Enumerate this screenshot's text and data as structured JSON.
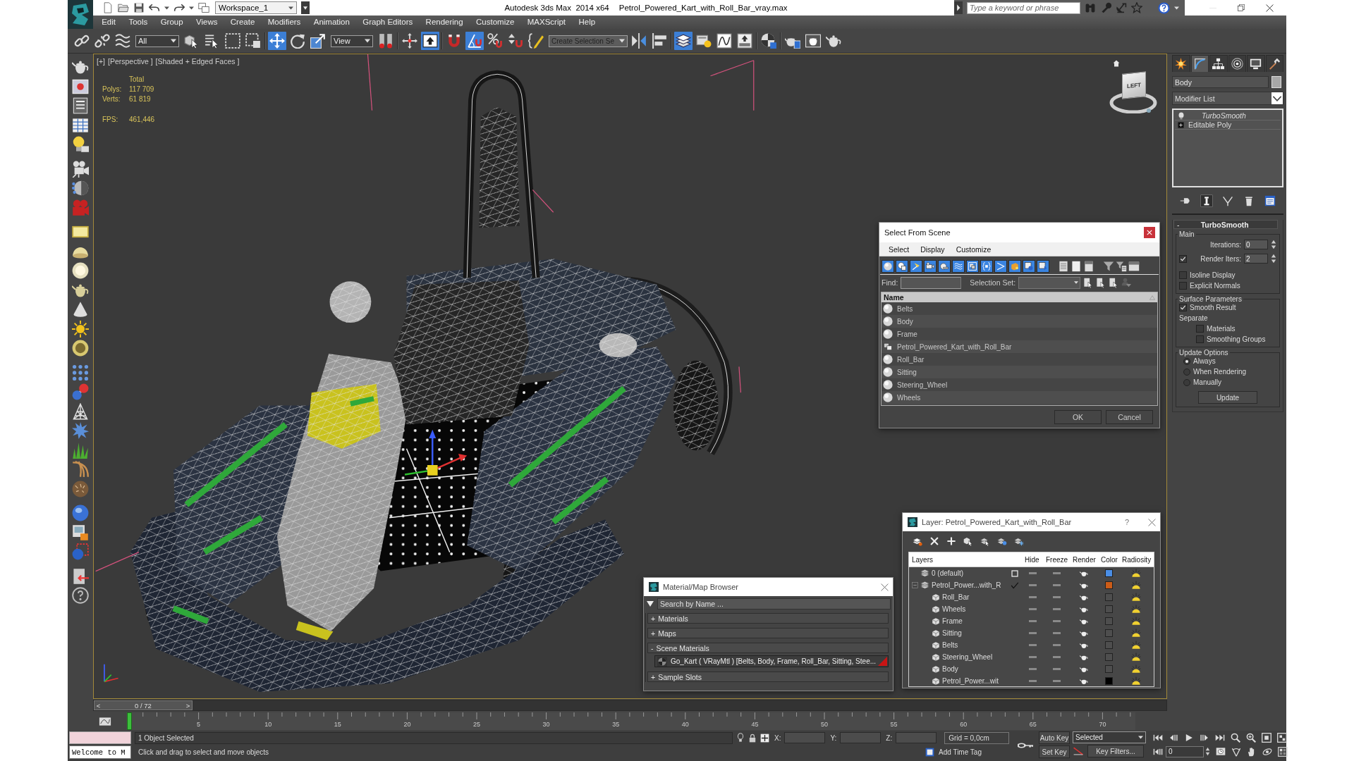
{
  "title_bar": {
    "workspace": "Workspace_1",
    "app_title": "Autodesk 3ds Max  2014 x64",
    "file_name": "Petrol_Powered_Kart_with_Roll_Bar_vray.max",
    "search": {
      "placeholder": "Type a keyword or phrase"
    }
  },
  "menu": [
    "Edit",
    "Tools",
    "Group",
    "Views",
    "Create",
    "Modifiers",
    "Animation",
    "Graph Editors",
    "Rendering",
    "Customize",
    "MAXScript",
    "Help"
  ],
  "main_toolbar": {
    "tools": [
      {
        "selected": false
      },
      {
        "selected": false
      },
      {
        "selected": false
      },
      {
        "selected": false
      },
      {
        "selected": false
      },
      {
        "selected": false
      },
      {
        "selected": false
      },
      {
        "selected": true
      },
      {
        "selected": false
      },
      {
        "selected": false
      },
      {
        "selected": false
      },
      {
        "selected": false
      },
      {
        "selected": true
      },
      {
        "selected": false
      },
      {
        "selected": true
      },
      {
        "selected": false
      },
      {
        "selected": false
      },
      {
        "selected": false
      },
      {
        "selected": false
      },
      {
        "selected": false
      },
      {
        "selected": true
      },
      {
        "selected": false
      },
      {
        "selected": false
      },
      {
        "selected": false
      },
      {
        "selected": false
      },
      {
        "selected": false
      },
      {
        "selected": false
      },
      {
        "selected": false
      }
    ],
    "selection_filter": "All",
    "reference_coordinate_system": "View",
    "named_selection_set": "Create Selection Se"
  },
  "viewport": {
    "labels": [
      "[+]",
      "[Perspective ]",
      "[Shaded + Edged Faces ]"
    ],
    "stats": {
      "heading": "Total",
      "rows": [
        {
          "label": "Polys:",
          "value": "117 709"
        },
        {
          "label": "Verts:",
          "value": "61 819"
        }
      ],
      "fps": {
        "label": "FPS:",
        "value": "461,446"
      }
    },
    "view_cube": {
      "face": "LEFT"
    }
  },
  "command_panel": {
    "tabs": [
      {
        "selected": false
      },
      {
        "selected": true
      },
      {
        "selected": false
      },
      {
        "selected": false
      },
      {
        "selected": false
      },
      {
        "selected": false
      }
    ],
    "object_name": "Body",
    "modifier_list": "Modifier List",
    "stack": [
      {
        "label": "TurboSmooth",
        "kind": "modifier"
      },
      {
        "label": "Editable Poly",
        "kind": "base_object",
        "expanded": false
      }
    ],
    "stack_tools": [
      {
        "selected": false
      },
      {
        "selected": true
      },
      {
        "selected": false
      },
      {
        "selected": false
      },
      {
        "selected": false
      }
    ],
    "rollout": {
      "sign": "-",
      "title": "TurboSmooth",
      "groups": [
        {
          "title": "Main",
          "controls": [
            {
              "kind": "spinner",
              "label": "Iterations:",
              "value": "0"
            },
            {
              "kind": "checkbox_spinner",
              "label": "Render Iters:",
              "value": "2",
              "checked": true
            },
            {
              "kind": "checkbox",
              "label": "Isoline Display",
              "checked": false
            },
            {
              "kind": "checkbox",
              "label": "Explicit Normals",
              "checked": false
            }
          ]
        },
        {
          "title": "Surface Parameters",
          "controls": [
            {
              "kind": "checkbox",
              "label": "Smooth Result",
              "checked": true
            },
            {
              "kind": "label",
              "label": "Separate",
              "children": [
                {
                  "kind": "checkbox",
                  "label": "Materials",
                  "checked": false
                },
                {
                  "kind": "checkbox",
                  "label": "Smoothing Groups",
                  "checked": false
                }
              ]
            }
          ]
        },
        {
          "title": "Update Options",
          "controls": [
            {
              "kind": "radio",
              "label": "Always",
              "selected": true
            },
            {
              "kind": "radio",
              "label": "When Rendering",
              "selected": false
            },
            {
              "kind": "radio",
              "label": "Manually",
              "selected": false
            },
            {
              "kind": "button",
              "label": "Update"
            }
          ]
        }
      ]
    }
  },
  "select_from_scene": {
    "title": "Select From Scene",
    "menu": [
      "Select",
      "Display",
      "Customize"
    ],
    "filters": [
      {
        "selected": true
      },
      {
        "selected": true
      },
      {
        "selected": true
      },
      {
        "selected": true
      },
      {
        "selected": true
      },
      {
        "selected": true
      },
      {
        "selected": true
      },
      {
        "selected": true
      },
      {
        "selected": true
      },
      {
        "selected": true
      },
      {
        "selected": true
      },
      {
        "selected": true
      }
    ],
    "find": {
      "label": "Find:"
    },
    "selection_set": {
      "label": "Selection Set:"
    },
    "column": "Name",
    "rows": [
      {
        "name": "Belts",
        "kind": "geometry",
        "selected": false
      },
      {
        "name": "Body",
        "kind": "geometry",
        "selected": false
      },
      {
        "name": "Frame",
        "kind": "geometry",
        "selected": false
      },
      {
        "name": "Petrol_Powered_Kart_with_Roll_Bar",
        "kind": "group",
        "selected": false
      },
      {
        "name": "Roll_Bar",
        "kind": "geometry",
        "selected": false
      },
      {
        "name": "Sitting",
        "kind": "geometry",
        "selected": false
      },
      {
        "name": "Steering_Wheel",
        "kind": "geometry",
        "selected": false
      },
      {
        "name": "Wheels",
        "kind": "geometry",
        "selected": false
      }
    ],
    "buttons": [
      "OK",
      "Cancel"
    ]
  },
  "material_browser": {
    "title": "Material/Map Browser",
    "search": {
      "placeholder": "Search by Name ..."
    },
    "sections": [
      {
        "sign": "+",
        "label": "Materials"
      },
      {
        "sign": "+",
        "label": "Maps"
      },
      {
        "sign": "-",
        "label": "Scene Materials",
        "items": [
          {
            "label": "Go_Kart ( VRayMtl ) [Belts, Body, Frame, Roll_Bar, Sitting, Stee..."
          }
        ]
      },
      {
        "sign": "+",
        "label": "Sample Slots"
      }
    ]
  },
  "layer_manager": {
    "title": "Layer: Petrol_Powered_Kart_with_Roll_Bar",
    "help": "?",
    "columns": [
      "Layers",
      "Hide",
      "Freeze",
      "Render",
      "Color",
      "Radiosity"
    ],
    "layers": [
      {
        "name": "0 (default)",
        "kind": "layer",
        "current": false,
        "selected": false,
        "color": "#4a8ee6"
      },
      {
        "name": "Petrol_Power...with_R",
        "kind": "layer",
        "current": true,
        "selected": false,
        "expanded": true,
        "color": "#cc5c18",
        "children": [
          {
            "name": "Roll_Bar",
            "kind": "object",
            "selected": false,
            "color": "#4e4e4e"
          },
          {
            "name": "Wheels",
            "kind": "object",
            "selected": false,
            "color": "#4e4e4e"
          },
          {
            "name": "Frame",
            "kind": "object",
            "selected": false,
            "color": "#4e4e4e"
          },
          {
            "name": "Sitting",
            "kind": "object",
            "selected": false,
            "color": "#4e4e4e"
          },
          {
            "name": "Belts",
            "kind": "object",
            "selected": false,
            "color": "#4e4e4e"
          },
          {
            "name": "Steering_Wheel",
            "kind": "object",
            "selected": false,
            "color": "#4e4e4e"
          },
          {
            "name": "Body",
            "kind": "object",
            "selected": false,
            "color": "#4e4e4e"
          },
          {
            "name": "Petrol_Power...wit",
            "kind": "object",
            "selected": false,
            "color": "#000000"
          }
        ]
      }
    ]
  },
  "time_slider": {
    "previous": "<",
    "label": "0 / 72",
    "next": ">",
    "level": 0
  },
  "track_bar": {
    "labels": [
      "5",
      "10",
      "15",
      "20",
      "25",
      "30",
      "35",
      "40",
      "45",
      "50",
      "55",
      "60",
      "65",
      "70"
    ]
  },
  "status_bar": {
    "listener": {
      "value": "Welcome to M"
    },
    "selection_info": "1 Object Selected",
    "prompt": "Click and drag to select and move objects",
    "coordinates": [
      {
        "label": "X:"
      },
      {
        "label": "Y:"
      },
      {
        "label": "Z:"
      }
    ],
    "grid": "Grid = 0,0cm",
    "add_time_tag": "Add Time Tag",
    "auto_key": {
      "label": "Auto Key",
      "selected": false
    },
    "key_mode": "Selected",
    "set_key": "Set Key",
    "key_filters": "Key Filters...",
    "frame": "0"
  }
}
